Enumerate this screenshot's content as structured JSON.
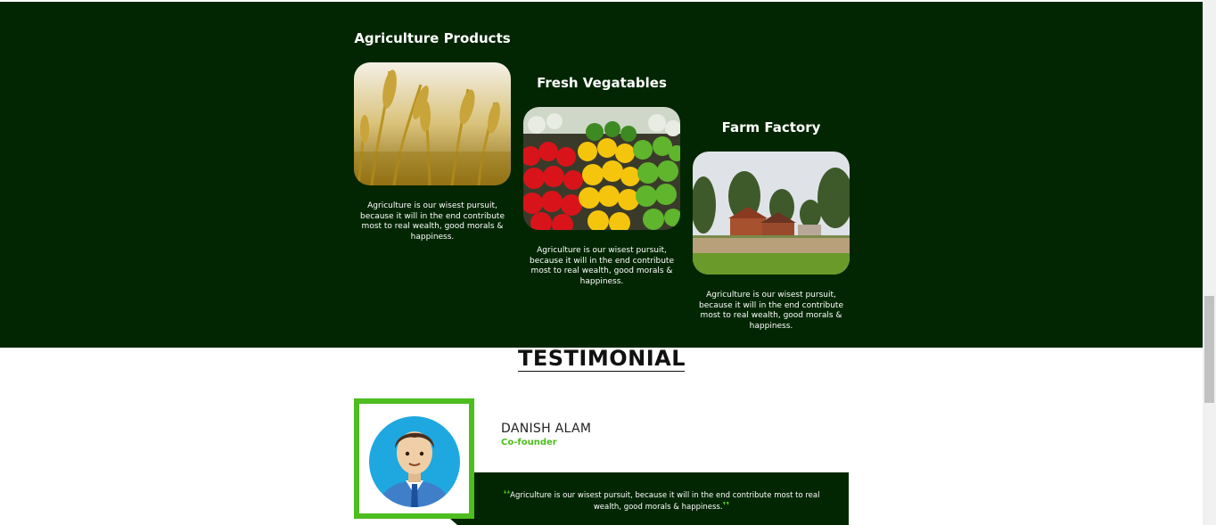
{
  "products": {
    "cards": [
      {
        "title": "Agriculture Products",
        "image": "wheat-field-photo",
        "text": "Agriculture is our wisest pursuit, because it will in the end contribute most to real wealth, good morals & happiness."
      },
      {
        "title": "Fresh Vegatables",
        "image": "bell-peppers-photo",
        "text": "Agriculture is our wisest pursuit, because it will in the end contribute most to real wealth, good morals & happiness."
      },
      {
        "title": "Farm Factory",
        "image": "farm-house-photo",
        "text": "Agriculture is our wisest pursuit, because it will in the end contribute most to real wealth, good morals & happiness."
      }
    ]
  },
  "testimonial": {
    "heading": "TESTIMONIAL",
    "name": "DANISH ALAM",
    "role": "Co-founder",
    "quote": "Agriculture is our wisest pursuit, because it will in the end contribute most to real wealth, good morals & happiness.",
    "avatar": "man-avatar-icon"
  },
  "colors": {
    "band_background": "#022602",
    "accent_green": "#4dbd1f"
  }
}
